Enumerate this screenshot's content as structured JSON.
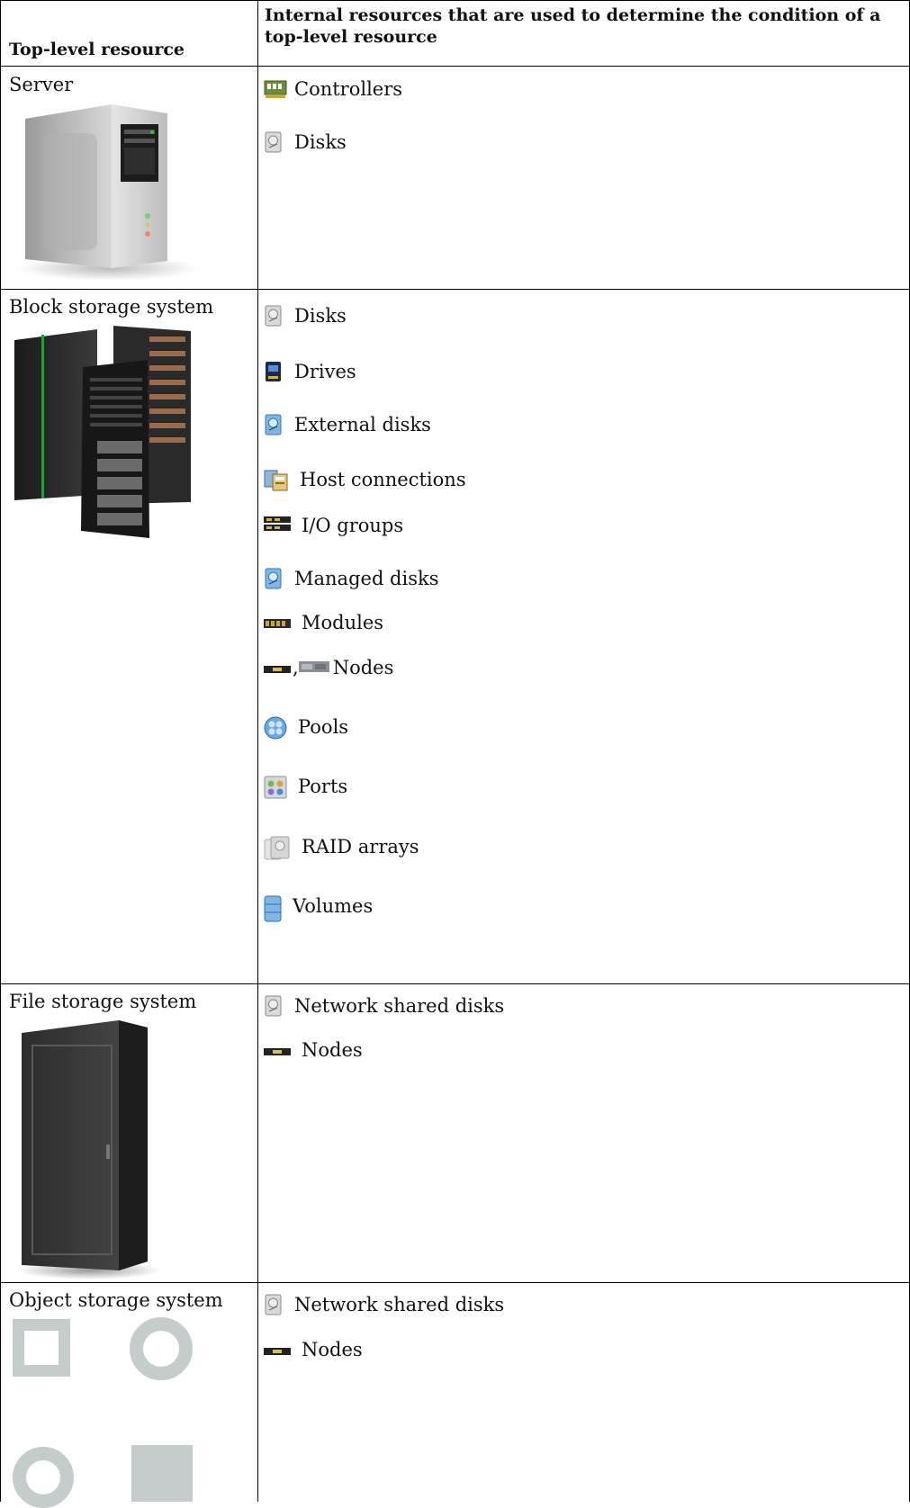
{
  "table": {
    "header": {
      "col1": "Top-level resource",
      "col2_line1": "Internal resources that are used to determine the condition of a",
      "col2_line2": "top-level resource"
    },
    "rows": [
      {
        "resource": "Server",
        "image": "server-tower-image",
        "items": [
          {
            "icon": "controller-icon",
            "label": "Controllers"
          },
          {
            "icon": "disk-icon",
            "label": "Disks"
          }
        ]
      },
      {
        "resource": "Block storage system",
        "image": "block-storage-racks-image",
        "items": [
          {
            "icon": "disk-icon",
            "label": "Disks"
          },
          {
            "icon": "drive-icon",
            "label": "Drives"
          },
          {
            "icon": "external-disk-icon",
            "label": "External disks"
          },
          {
            "icon": "host-connection-icon",
            "label": "Host connections"
          },
          {
            "icon": "io-group-icon",
            "label": "I/O groups"
          },
          {
            "icon": "managed-disk-icon",
            "label": "Managed disks"
          },
          {
            "icon": "module-icon",
            "label": "Modules"
          },
          {
            "icon": "node-icon",
            "label": ", ",
            "label2": "Nodes"
          },
          {
            "icon": "pool-icon",
            "label": "Pools"
          },
          {
            "icon": "port-icon",
            "label": "Ports"
          },
          {
            "icon": "raid-array-icon",
            "label": "RAID arrays"
          },
          {
            "icon": "volume-icon",
            "label": "Volumes"
          }
        ]
      },
      {
        "resource": "File storage system",
        "image": "file-storage-cabinet-image",
        "items": [
          {
            "icon": "network-shared-disk-icon",
            "label": "Network shared disks"
          },
          {
            "icon": "node-icon",
            "label": "Nodes"
          }
        ]
      },
      {
        "resource": "Object storage system",
        "image": "object-storage-shapes-image",
        "items": [
          {
            "icon": "network-shared-disk-icon",
            "label": "Network shared disks"
          },
          {
            "icon": "node-icon",
            "label": "Nodes"
          }
        ]
      }
    ]
  }
}
